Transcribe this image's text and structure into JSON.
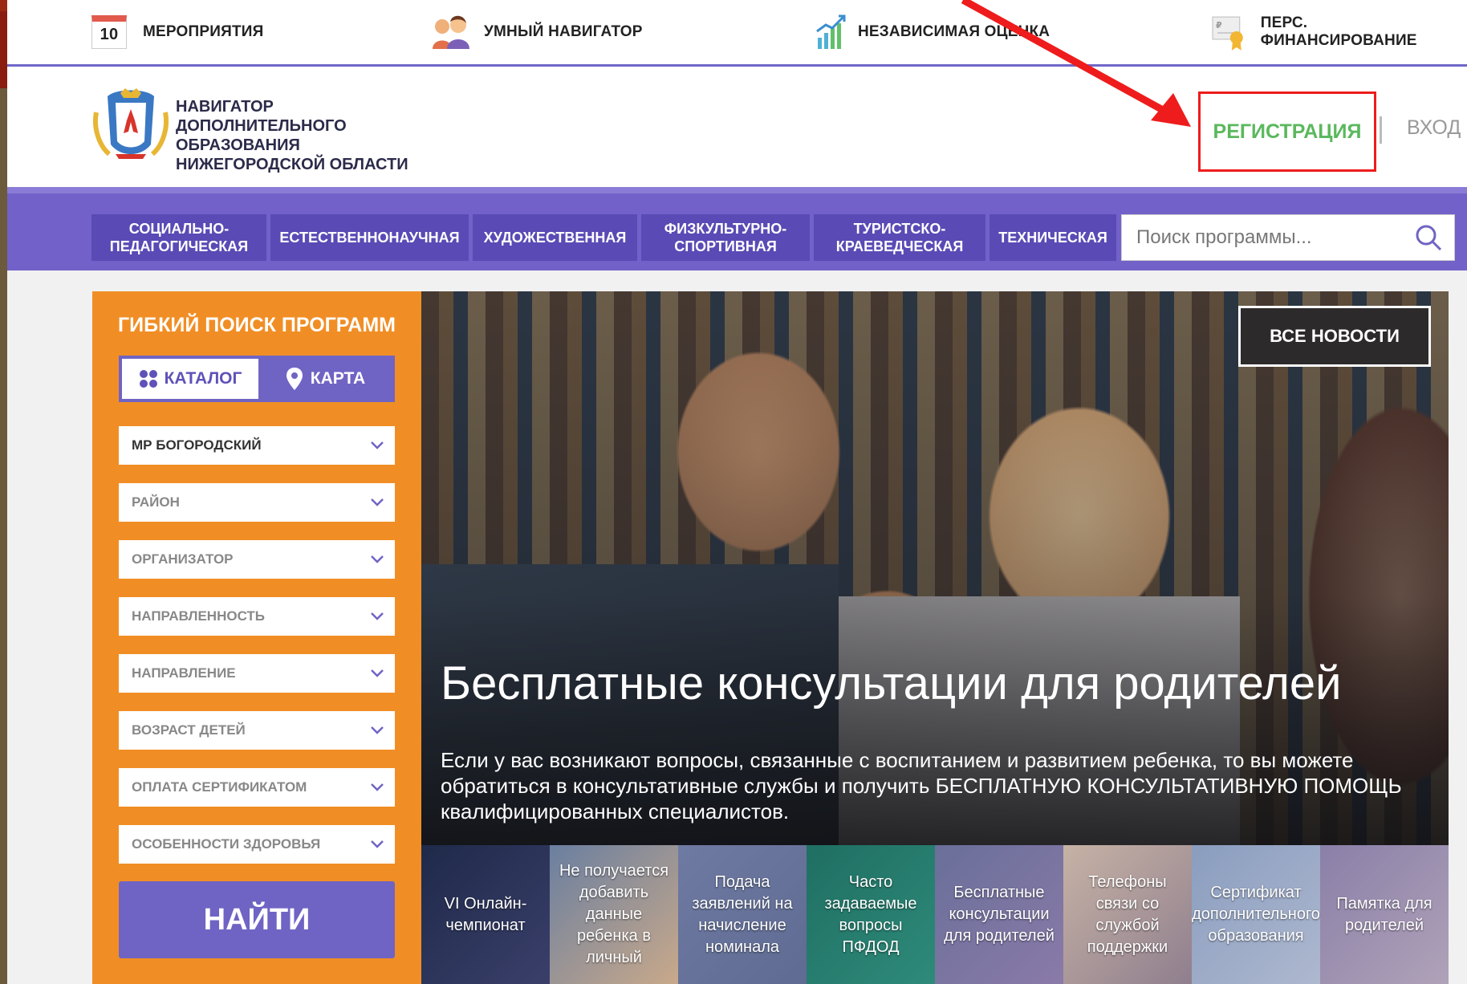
{
  "topnav": {
    "events": {
      "day": "10",
      "label": "МЕРОПРИЯТИЯ"
    },
    "smart_navigator": "УМНЫЙ НАВИГАТОР",
    "independent_assessment": "НЕЗАВИСИМАЯ ОЦЕНКА",
    "personal_financing": "ПЕРС. ФИНАНСИРОВАНИЕ"
  },
  "header": {
    "site_name": "НАВИГАТОР ДОПОЛНИТЕЛЬНОГО ОБРАЗОВАНИЯ НИЖЕГОРОДСКОЙ ОБЛАСТИ",
    "register": "РЕГИСТРАЦИЯ",
    "login": "ВХОД"
  },
  "categories": [
    "СОЦИАЛЬНО-ПЕДАГОГИЧЕСКАЯ",
    "ЕСТЕСТВЕННОНАУЧНАЯ",
    "ХУДОЖЕСТВЕННАЯ",
    "ФИЗКУЛЬТУРНО-СПОРТИВНАЯ",
    "ТУРИСТСКО-КРАЕВЕДЧЕСКАЯ",
    "ТЕХНИЧЕСКАЯ"
  ],
  "search": {
    "placeholder": "Поиск программы..."
  },
  "filter": {
    "title": "ГИБКИЙ ПОИСК ПРОГРАММ",
    "catalog": "КАТАЛОГ",
    "map": "КАРТА",
    "dropdowns": [
      "МР БОГОРОДСКИЙ",
      "РАЙОН",
      "ОРГАНИЗАТОР",
      "НАПРАВЛЕННОСТЬ",
      "НАПРАВЛЕНИЕ",
      "ВОЗРАСТ ДЕТЕЙ",
      "ОПЛАТА СЕРТИФИКАТОМ",
      "ОСОБЕННОСТИ ЗДОРОВЬЯ"
    ],
    "find": "НАЙТИ"
  },
  "hero": {
    "all_news": "ВСЕ НОВОСТИ",
    "title": "Бесплатные консультации для родителей",
    "text": "Если у вас возникают вопросы, связанные с воспитанием и развитием ребенка, то вы можете обратиться в консультативные службы и получить БЕСПЛАТНУЮ КОНСУЛЬТАТИВНУЮ ПОМОЩЬ квалифицированных специалистов."
  },
  "news": [
    "VI Онлайн-чемпионат",
    "Не получается добавить данные ребенка в личный",
    "Подача заявлений на начисление номинала",
    "Часто задаваемые вопросы ПФДОД",
    "Бесплатные консультации для родителей",
    "Телефоны связи со службой поддержки",
    "Сертификат дополнительного образования",
    "Памятка для родителей"
  ],
  "colors": {
    "purple": "#7161c8",
    "orange": "#f08e25",
    "green": "#5bb85d",
    "annotation_red": "#ee1c1c"
  }
}
